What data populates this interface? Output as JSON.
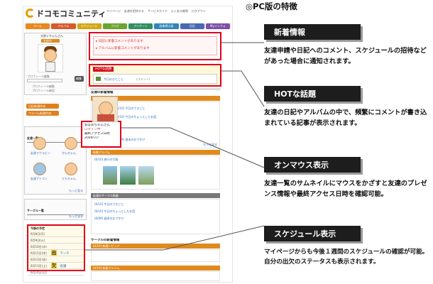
{
  "page_heading": "◎PC版の特徴",
  "app": {
    "logo": "ドコモコミュニティ",
    "top_links": [
      "マイページ",
      "友達を招待する",
      "サービスガイド",
      "よくある質問",
      "ログアウト"
    ],
    "nav_tabs": [
      {
        "label": "ホーム",
        "color": "#e8891d"
      },
      {
        "label": "アルバム",
        "color": "#d65a2b"
      },
      {
        "label": "スケジュール",
        "color": "#d4a615"
      },
      {
        "label": "ブログ",
        "color": "#6aa52c"
      },
      {
        "label": "アンケート",
        "color": "#2f8f63"
      },
      {
        "label": "画像掲示板",
        "color": "#2d86b8"
      },
      {
        "label": "日記",
        "color": "#4a67b4"
      },
      {
        "label": "Myインフォ",
        "color": "#7c4fa8"
      }
    ]
  },
  "profile": {
    "name": "太郎ぐちゃんさん",
    "status": "名前中",
    "edit_button": "編集",
    "links": [
      "プロフィール編集",
      "プロフィール確認"
    ]
  },
  "left_buttons": [
    "日記新規作成",
    "アルバム新規作成"
  ],
  "friends_header": "友達一覧",
  "friends": [
    "友達マクラビン",
    "かんちゃん",
    "友達アイコン",
    "ともちゃん"
  ],
  "more_link": "もっと見る",
  "circle_header": "サークル一覧",
  "schedule": {
    "header": "今後の予定",
    "rows": [
      {
        "date": "6月8日(月)",
        "mark": "",
        "text": ""
      },
      {
        "date": "6月9日(火)",
        "mark": "",
        "text": ""
      },
      {
        "date": "6月10日(水)",
        "mark": "",
        "text": ""
      },
      {
        "date": "6月11日(木)",
        "mark": "出",
        "text": "ランチ"
      },
      {
        "date": "6月12日(金)",
        "mark": "",
        "text": ""
      },
      {
        "date": "6月13日(土)",
        "mark": "欠",
        "text": "会議"
      },
      {
        "date": "6月14日(日)",
        "mark": "",
        "text": ""
      }
    ]
  },
  "notices": [
    "日記に新着コメントがあります",
    "アルバムに新着コメントがあります"
  ],
  "hot": {
    "label": "HOTな話題",
    "item": "今日のひとこと",
    "count": "(コメント)"
  },
  "friend_updates": {
    "header": "友達の新着情報",
    "diary_label": "新着日記",
    "album_label": "新着アルバム",
    "circle_label": "友達のサークル新着",
    "diary_items": [
      "[6/10] 今日のできごと",
      "[6/10] 今日のちょっとしたお話",
      "[6/09] 週末のおでかけ"
    ],
    "album_items": [
      "[6/10] 旅行の写真",
      "[6/09] ペットの写真"
    ]
  },
  "hover_popup": {
    "lines": [
      "おばあちゃんさん",
      "ログイン中",
      "最終アクセス日時",
      "2009/7/7"
    ]
  },
  "circle_updates": {
    "header": "サークルの新着情報",
    "items": [
      "[6/10] 新規トピック",
      "[6/10] 新着アルバム"
    ]
  },
  "callouts": [
    {
      "title": "新着情報",
      "text": "友達申請や日記へのコメント、スケジュールの招待などがあった場合に通知されます。"
    },
    {
      "title": "HOTな話題",
      "text": "友達の日記やアルバムの中で、頻繁にコメントが書き込まれている記事が表示されます。"
    },
    {
      "title": "オンマウス表示",
      "text": "友達一覧のサムネイルにマウスをかざすと友達のプレゼンス情報や最終アクセス日時を確認可能。"
    },
    {
      "title": "スケジュール表示",
      "text": "マイページからも今後１週間のスケジュールの確認が可能。自分の出欠のステータスも表示されます。"
    }
  ],
  "colors": {
    "highlight_red": "#e0001b",
    "callout_bg": "#1d1d1d",
    "accent_orange": "#e08a1e"
  }
}
